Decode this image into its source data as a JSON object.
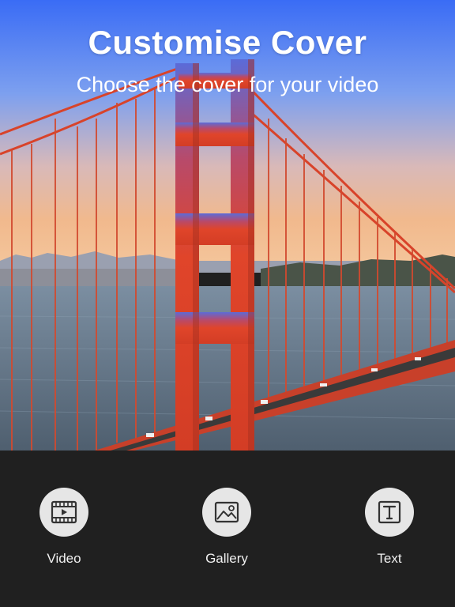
{
  "header": {
    "title": "Customise Cover",
    "subtitle": "Choose the cover for your video"
  },
  "cover_image": {
    "subject": "golden-gate-bridge-photo"
  },
  "toolbar": {
    "items": [
      {
        "label": "Video",
        "icon": "film-play-icon"
      },
      {
        "label": "Gallery",
        "icon": "image-icon"
      },
      {
        "label": "Text",
        "icon": "text-box-icon"
      }
    ]
  },
  "colors": {
    "sky_top": "#3b6cf6",
    "sky_bottom": "#f3b98a",
    "bridge": "#e0492d",
    "water": "#5a6a7a",
    "toolbar_bg": "#202020",
    "icon_circle": "#e6e6e6"
  }
}
